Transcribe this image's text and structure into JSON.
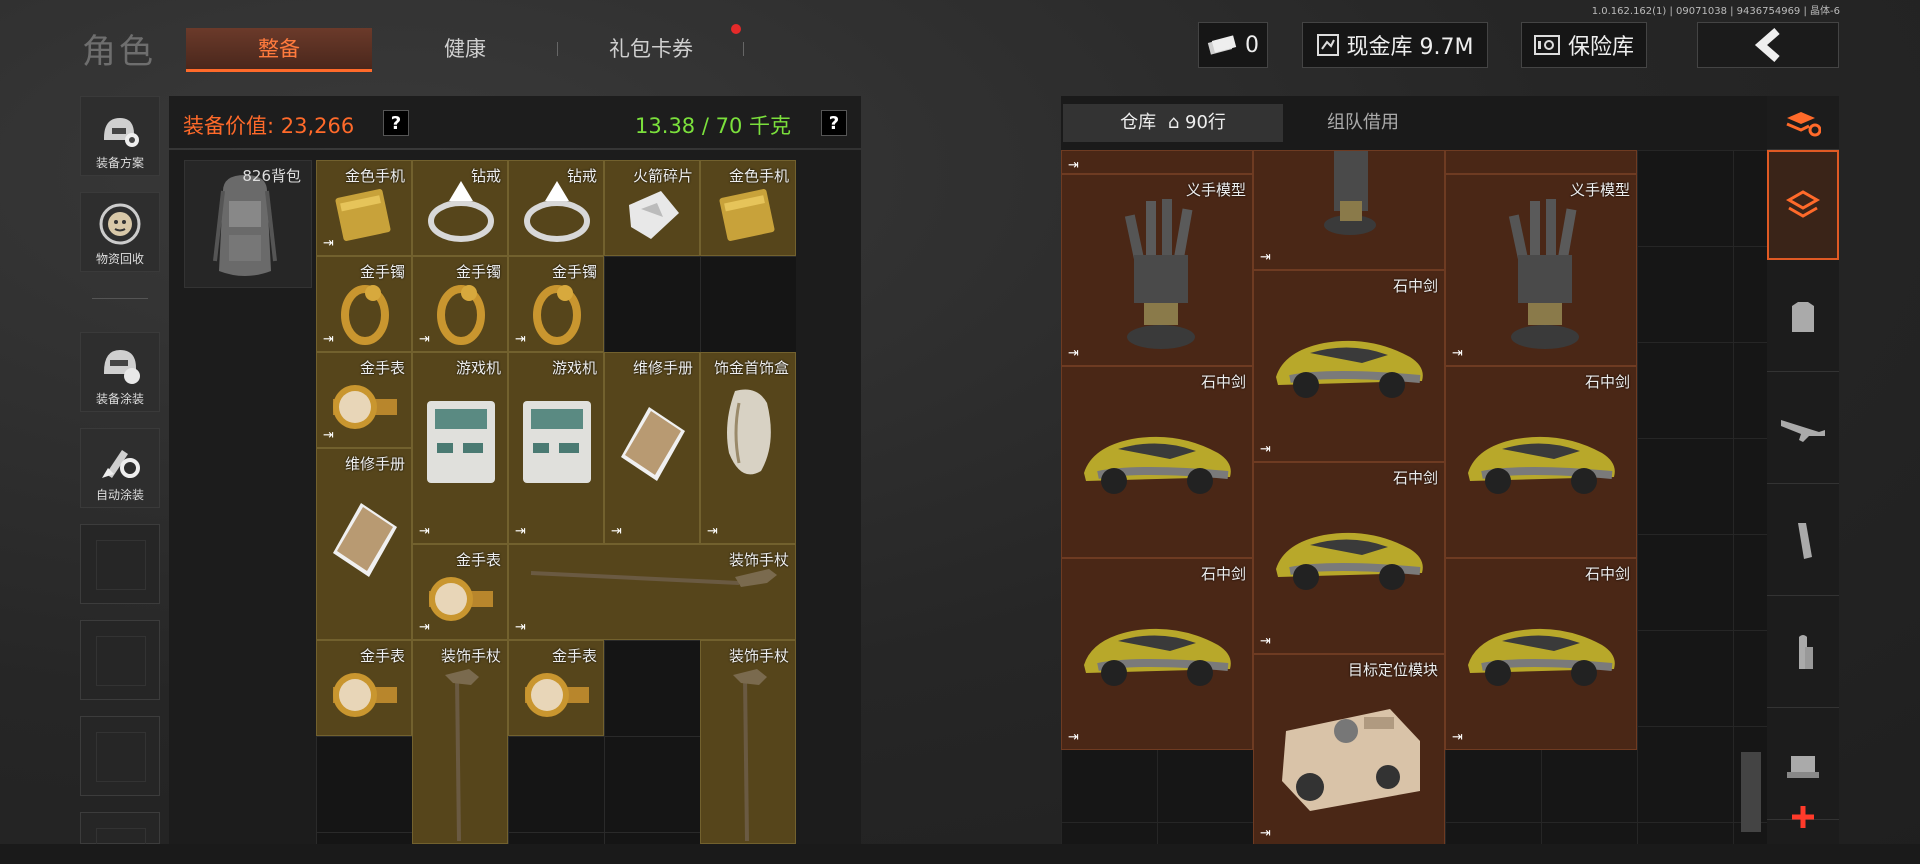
{
  "header": {
    "version": "1.0.162.162(1) | 09071038 | 9436754969 | 晶体-6",
    "title": "角色",
    "tabs": [
      {
        "label": "整备",
        "active": true
      },
      {
        "label": "健康",
        "active": false
      },
      {
        "label": "礼包卡券",
        "active": false,
        "notification": true
      }
    ],
    "currency_count": "0",
    "cash_vault": "现金库 9.7M",
    "safe_label": "保险库"
  },
  "left_nav": [
    {
      "label": "装备方案",
      "icon": "helmet-gear-icon"
    },
    {
      "label": "物资回收",
      "icon": "recycle-face-icon"
    },
    {
      "label": "装备涂装",
      "icon": "helmet-paint-icon"
    },
    {
      "label": "自动涂装",
      "icon": "brush-gear-icon"
    }
  ],
  "equipment": {
    "value_label": "装备价值: 23,266",
    "weight_label": "13.38 / 70 千克",
    "help": "?",
    "bag_label": "826背包",
    "items": [
      {
        "name": "金色手机",
        "icon": "gold-phone-icon"
      },
      {
        "name": "钻戒",
        "icon": "diamond-ring-icon"
      },
      {
        "name": "钻戒",
        "icon": "diamond-ring-icon"
      },
      {
        "name": "火箭碎片",
        "icon": "rocket-shard-icon"
      },
      {
        "name": "金色手机",
        "icon": "gold-phone-icon"
      },
      {
        "name": "金手镯",
        "icon": "gold-bracelet-icon"
      },
      {
        "name": "金手镯",
        "icon": "gold-bracelet-icon"
      },
      {
        "name": "金手镯",
        "icon": "gold-bracelet-icon"
      },
      {
        "name": "金手表",
        "icon": "gold-watch-icon"
      },
      {
        "name": "游戏机",
        "icon": "game-console-icon"
      },
      {
        "name": "游戏机",
        "icon": "game-console-icon"
      },
      {
        "name": "维修手册",
        "icon": "repair-manual-icon"
      },
      {
        "name": "饰金首饰盒",
        "icon": "jewelry-box-icon"
      },
      {
        "name": "维修手册",
        "icon": "repair-manual-icon"
      },
      {
        "name": "金手表",
        "icon": "gold-watch-icon"
      },
      {
        "name": "装饰手杖",
        "icon": "cane-icon"
      },
      {
        "name": "金手表",
        "icon": "gold-watch-icon"
      },
      {
        "name": "装饰手杖",
        "icon": "cane-icon"
      },
      {
        "name": "金手表",
        "icon": "gold-watch-icon"
      },
      {
        "name": "装饰手杖",
        "icon": "cane-icon"
      }
    ]
  },
  "warehouse": {
    "tab_storage": "仓库",
    "rows": "90行",
    "tab_team": "组队借用",
    "items": [
      {
        "name": "义手模型",
        "icon": "prosthetic-hand-icon"
      },
      {
        "name": "义手模型",
        "icon": "prosthetic-hand-icon"
      },
      {
        "name": "石中剑",
        "icon": "sports-car-icon"
      },
      {
        "name": "石中剑",
        "icon": "sports-car-icon"
      },
      {
        "name": "石中剑",
        "icon": "sports-car-icon"
      },
      {
        "name": "石中剑",
        "icon": "sports-car-icon"
      },
      {
        "name": "石中剑",
        "icon": "sports-car-icon"
      },
      {
        "name": "石中剑",
        "icon": "sports-car-icon"
      },
      {
        "name": "目标定位模块",
        "icon": "target-locator-icon"
      }
    ]
  },
  "right_side": [
    {
      "icon": "stack-refresh-icon"
    },
    {
      "icon": "all-items-icon"
    },
    {
      "icon": "armor-vest-icon"
    },
    {
      "icon": "rifle-icon"
    },
    {
      "icon": "magazine-icon"
    },
    {
      "icon": "ammo-icon"
    },
    {
      "icon": "scope-icon"
    },
    {
      "icon": "plus-icon"
    }
  ],
  "colors": {
    "accent": "#ff6a2a",
    "weight_ok": "#7be03c",
    "equip_cell": "#56451b",
    "ware_cell": "#4a2716"
  }
}
